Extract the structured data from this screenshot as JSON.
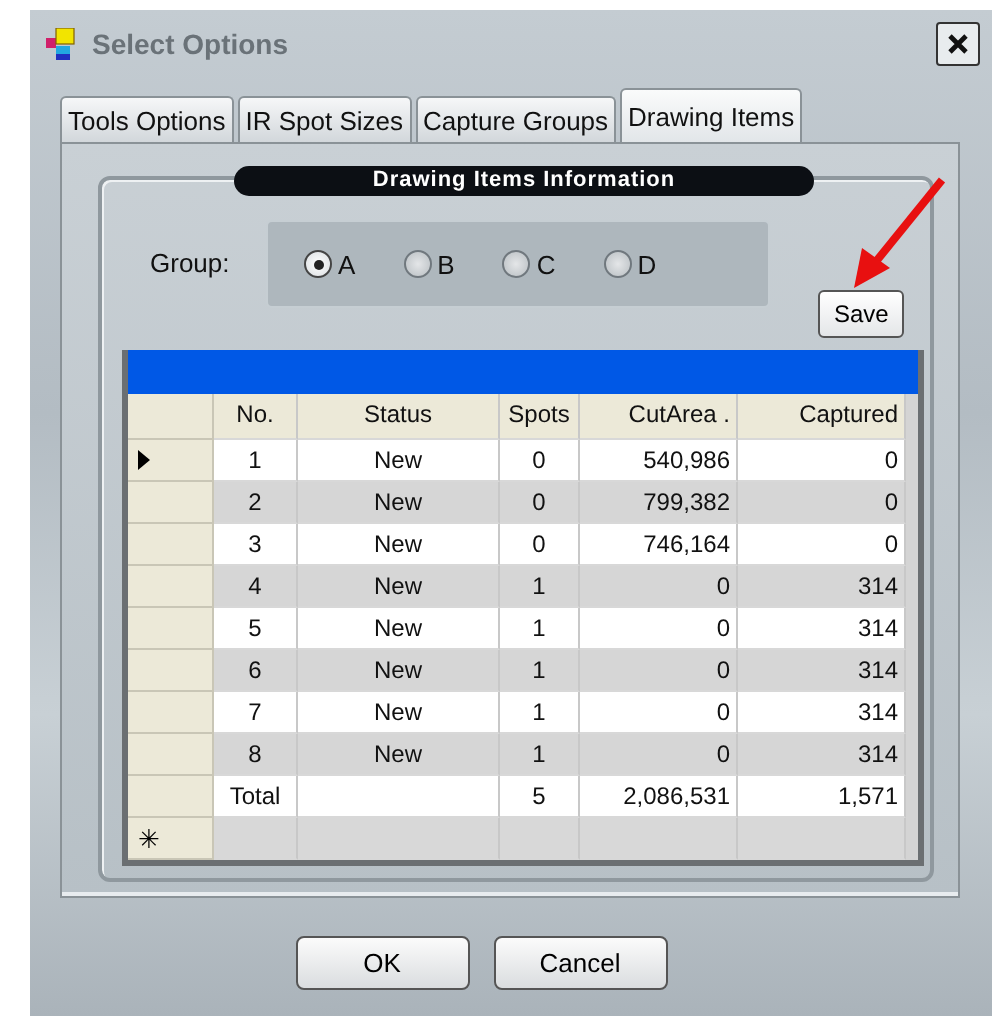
{
  "window": {
    "title": "Select Options"
  },
  "tabs": [
    {
      "label": "Tools Options",
      "selected": false
    },
    {
      "label": "IR Spot Sizes",
      "selected": false
    },
    {
      "label": "Capture Groups",
      "selected": false
    },
    {
      "label": "Drawing Items",
      "selected": true
    }
  ],
  "section_title": "Drawing Items Information",
  "group": {
    "label": "Group:",
    "options": [
      {
        "label": "A",
        "selected": true
      },
      {
        "label": "B",
        "selected": false
      },
      {
        "label": "C",
        "selected": false
      },
      {
        "label": "D",
        "selected": false
      }
    ]
  },
  "save_button": "Save",
  "table": {
    "columns": [
      "No.",
      "Status",
      "Spots",
      "CutArea .",
      "Captured"
    ],
    "rows": [
      {
        "cells": [
          "1",
          "New",
          "0",
          "540,986",
          "0"
        ],
        "current": true
      },
      {
        "cells": [
          "2",
          "New",
          "0",
          "799,382",
          "0"
        ],
        "current": false
      },
      {
        "cells": [
          "3",
          "New",
          "0",
          "746,164",
          "0"
        ],
        "current": false
      },
      {
        "cells": [
          "4",
          "New",
          "1",
          "0",
          "314"
        ],
        "current": false
      },
      {
        "cells": [
          "5",
          "New",
          "1",
          "0",
          "314"
        ],
        "current": false
      },
      {
        "cells": [
          "6",
          "New",
          "1",
          "0",
          "314"
        ],
        "current": false
      },
      {
        "cells": [
          "7",
          "New",
          "1",
          "0",
          "314"
        ],
        "current": false
      },
      {
        "cells": [
          "8",
          "New",
          "1",
          "0",
          "314"
        ],
        "current": false
      },
      {
        "cells": [
          "Total",
          "",
          "5",
          "2,086,531",
          "1,571"
        ],
        "current": false
      }
    ],
    "new_row_marker": "✳"
  },
  "buttons": [
    "OK",
    "Cancel"
  ]
}
